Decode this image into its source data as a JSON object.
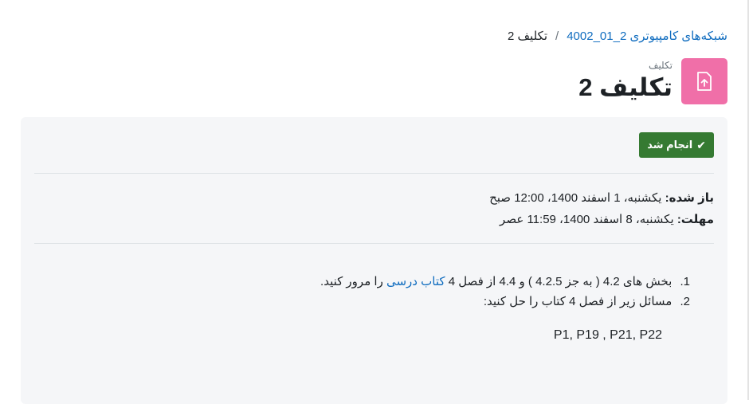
{
  "breadcrumb": {
    "course": "شبکه‌های کامپیوتری 2_01_4002",
    "separator": "/",
    "current": "تکلیف 2"
  },
  "header": {
    "pretitle": "تکلیف",
    "title": "تکلیف 2",
    "icon": "assignment-upload-icon",
    "icon_color": "#f06fa8"
  },
  "completion": {
    "label": "انجام شد",
    "color": "#357a32"
  },
  "dates": {
    "opened_label": "باز شده:",
    "opened_value": "یکشنبه، 1 اسفند 1400، 12:00 صبح",
    "due_label": "مهلت:",
    "due_value": "یکشنبه، 8 اسفند 1400، 11:59 عصر"
  },
  "description": {
    "item1_num": "1.",
    "item1_text_a": "بخش های 4.2 ( به جز 4.2.5 ) و 4.4 از فصل 4",
    "item1_link": "کتاب درسی",
    "item1_text_b": "را مرور کنید.",
    "item2_num": "2.",
    "item2_text": "مسائل زیر از فصل 4 کتاب را حل کنید:",
    "problems": "P1, P19 , P21, P22"
  }
}
